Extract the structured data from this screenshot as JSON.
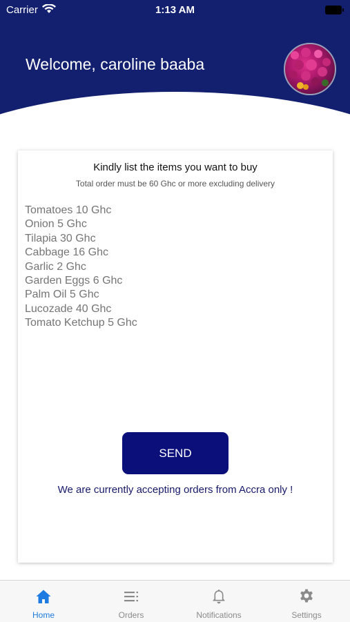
{
  "status_bar": {
    "carrier": "Carrier",
    "time": "1:13 AM"
  },
  "header": {
    "welcome": "Welcome, caroline baaba"
  },
  "order_card": {
    "title": "Kindly list the items you want to buy",
    "subtitle": "Total order must be 60 Ghc or more excluding delivery",
    "items_placeholder": "Tomatoes 10 Ghc\nOnion 5 Ghc\nTilapia 30 Ghc\nCabbage 16 Ghc\nGarlic 2 Ghc\nGarden Eggs 6 Ghc\nPalm Oil 5 Ghc\nLucozade 40 Ghc\nTomato Ketchup 5 Ghc",
    "send_label": "SEND",
    "notice": "We are currently accepting orders from Accra only !"
  },
  "tabbar": {
    "tabs": [
      {
        "label": "Home",
        "icon": "home-icon",
        "active": true
      },
      {
        "label": "Orders",
        "icon": "list-icon",
        "active": false
      },
      {
        "label": "Notifications",
        "icon": "bell-icon",
        "active": false
      },
      {
        "label": "Settings",
        "icon": "gear-icon",
        "active": false
      }
    ]
  },
  "colors": {
    "header_bg": "#13206f",
    "button_bg": "#0b0f7a",
    "active_tab": "#1e7be2",
    "inactive_tab": "#8a8a8a"
  }
}
